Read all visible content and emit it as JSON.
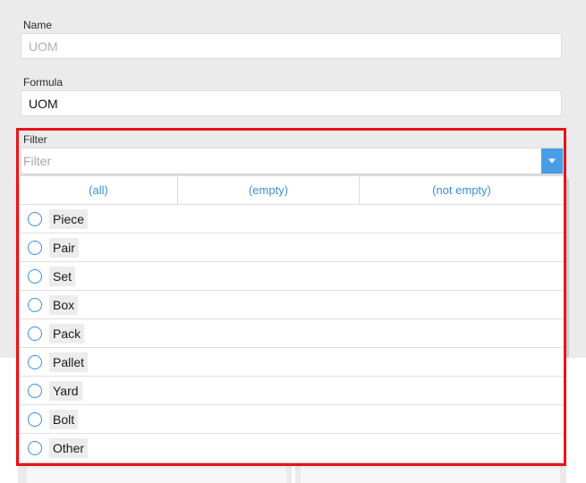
{
  "form": {
    "name_label": "Name",
    "name_placeholder": "UOM",
    "formula_label": "Formula",
    "formula_value": "UOM",
    "filter_label": "Filter",
    "filter_placeholder": "Filter"
  },
  "quick_filters": [
    "(all)",
    "(empty)",
    "(not empty)"
  ],
  "options": [
    "Piece",
    "Pair",
    "Set",
    "Box",
    "Pack",
    "Pallet",
    "Yard",
    "Bolt",
    "Other"
  ],
  "icons": {
    "dropdown": "chevron-down-icon",
    "radio": "radio-unchecked-icon"
  },
  "colors": {
    "accent": "#3b8fdc",
    "dropdown_button": "#4a9de8",
    "highlight_border": "#e8141b"
  }
}
